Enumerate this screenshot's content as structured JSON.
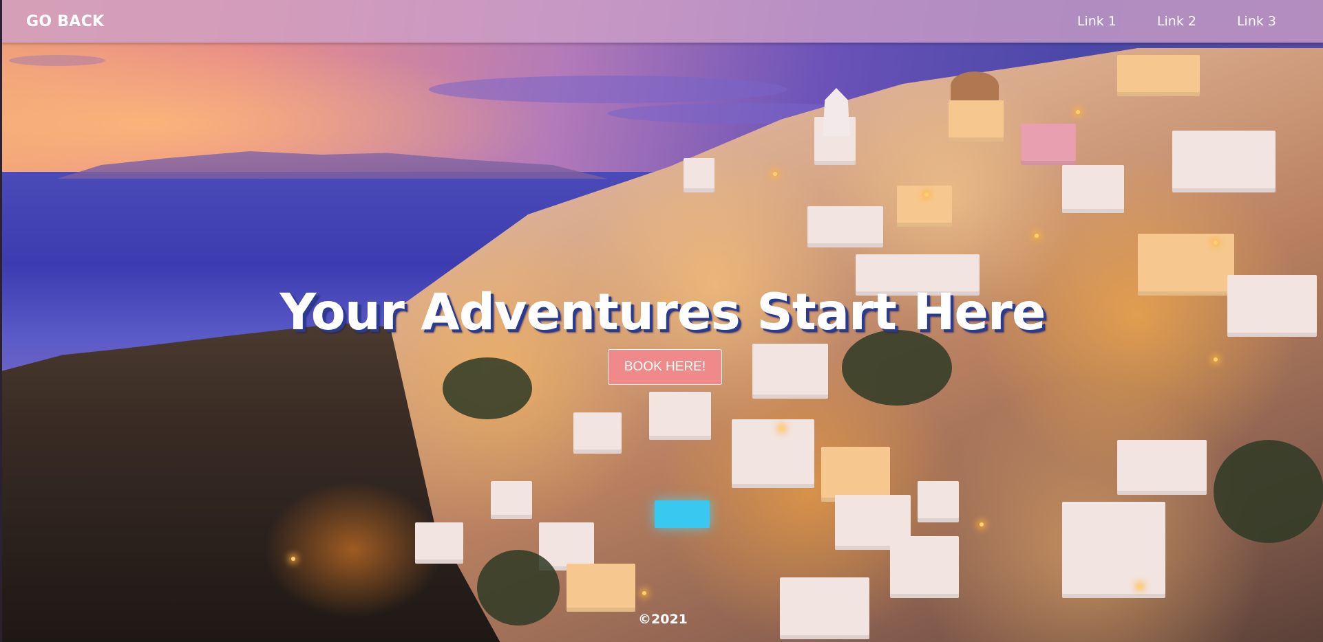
{
  "nav": {
    "brand_label": "GO BACK",
    "links": [
      {
        "label": "Link 1"
      },
      {
        "label": "Link 2"
      },
      {
        "label": "Link 3"
      }
    ]
  },
  "hero": {
    "title": "Your Adventures Start Here",
    "cta_label": "BOOK HERE!"
  },
  "footer": {
    "copyright": "©2021"
  },
  "colors": {
    "navbar": "#cda0c8",
    "cta_background": "#f08a8a",
    "title_shadow": "#2a3a8e",
    "text": "#ffffff"
  }
}
